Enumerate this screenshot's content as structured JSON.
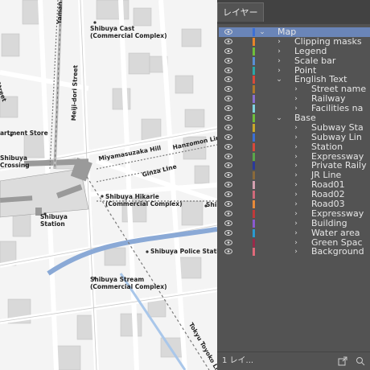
{
  "panel": {
    "tab_label": "レイヤー",
    "footer_count": "1 レイ...",
    "layers": [
      {
        "label": "Map",
        "depth": 0,
        "expanded": true,
        "color": "#3b6fd6",
        "selected": true
      },
      {
        "label": "Clipping masks",
        "depth": 1,
        "expanded": false,
        "color": "#e8842a"
      },
      {
        "label": "Legend",
        "depth": 1,
        "expanded": false,
        "color": "#6fbf3a"
      },
      {
        "label": "Scale bar",
        "depth": 1,
        "expanded": false,
        "color": "#5a8ed6"
      },
      {
        "label": "Point",
        "depth": 1,
        "expanded": false,
        "color": "#2aa8a8"
      },
      {
        "label": "English Text",
        "depth": 1,
        "expanded": true,
        "color": "#d94a3a"
      },
      {
        "label": "Street name",
        "depth": 2,
        "expanded": false,
        "color": "#b07a2a"
      },
      {
        "label": "Railway",
        "depth": 2,
        "expanded": false,
        "color": "#8a6fd0"
      },
      {
        "label": "Facilities na",
        "depth": 2,
        "expanded": false,
        "color": "#7fd4e0"
      },
      {
        "label": "Base",
        "depth": 1,
        "expanded": true,
        "color": "#6fbf3a"
      },
      {
        "label": "Subway Sta",
        "depth": 2,
        "expanded": false,
        "color": "#c9a82a"
      },
      {
        "label": "Subway Lin",
        "depth": 2,
        "expanded": false,
        "color": "#3a6fd6"
      },
      {
        "label": "Station",
        "depth": 2,
        "expanded": false,
        "color": "#d94a3a"
      },
      {
        "label": "Expressway",
        "depth": 2,
        "expanded": false,
        "color": "#5aa84a"
      },
      {
        "label": "Private Raily",
        "depth": 2,
        "expanded": false,
        "color": "#2a3a9a"
      },
      {
        "label": "JR Line",
        "depth": 2,
        "expanded": false,
        "color": "#8a6a3a"
      },
      {
        "label": "Road01",
        "depth": 2,
        "expanded": false,
        "color": "#d4a0b0"
      },
      {
        "label": "Road02",
        "depth": 2,
        "expanded": false,
        "color": "#d06a7a"
      },
      {
        "label": "Road03",
        "depth": 2,
        "expanded": false,
        "color": "#e88a3a"
      },
      {
        "label": "Expressway",
        "depth": 2,
        "expanded": false,
        "color": "#c23a3a"
      },
      {
        "label": "Building",
        "depth": 2,
        "expanded": false,
        "color": "#8a5ad0"
      },
      {
        "label": "Water area",
        "depth": 2,
        "expanded": false,
        "color": "#2a9ad0"
      },
      {
        "label": "Green Spac",
        "depth": 2,
        "expanded": false,
        "color": "#9a2a4a"
      },
      {
        "label": "Background",
        "depth": 2,
        "expanded": false,
        "color": "#e06a7a"
      }
    ]
  },
  "map": {
    "labels": {
      "shibuya_cast": "Shibuya Cast",
      "shibuya_cast_sub": "(Commercial Complex)",
      "yamanote": "Yaman",
      "meiji_dori": "Meiji-dori Street",
      "street_left": "Street",
      "apartment_store": "artment Store",
      "shibuya_crossing_1": "Shibuya",
      "shibuya_crossing_2": "Crossing",
      "miyamasuzaka": "Miyamasuzaka Hill",
      "hanzomon": "Hanzomon Line",
      "ginza": "Ginza Line",
      "hikarie": "Shibuya Hikarie",
      "hikarie_sub": "(Commercial Complex)",
      "shibu_right": "Shib",
      "station_1": "Shibuya",
      "station_2": "Station",
      "police": "Shibuya Police Station",
      "stream": "Shibuya Stream",
      "stream_sub": "(Commercial Complex)",
      "toyoko": "Tokyu Toyoko Li"
    }
  }
}
